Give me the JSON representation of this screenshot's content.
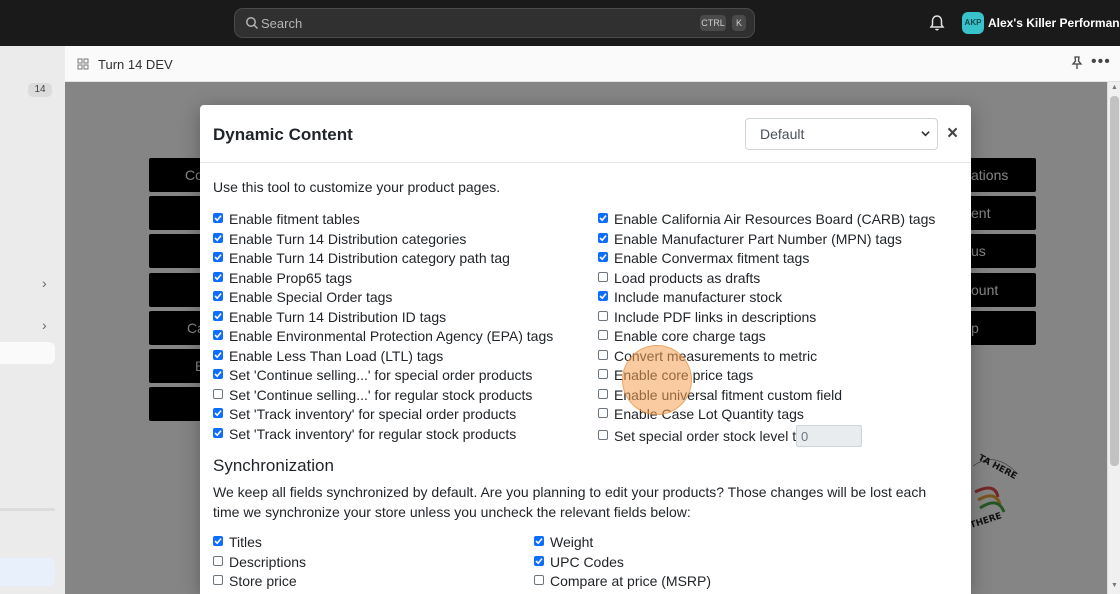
{
  "topbar": {
    "search_placeholder": "Search",
    "shortcut_keys": [
      "CTRL",
      "K"
    ],
    "account_initials": "AKP",
    "account_name": "Alex's Killer Performance"
  },
  "sidebar": {
    "badge": "14"
  },
  "app": {
    "title": "Turn 14 DEV"
  },
  "background_buttons": [
    "Co",
    "ations",
    "ent",
    "us",
    "ount",
    "Ca",
    "p",
    "B"
  ],
  "stamp_text": [
    "TA HERE",
    "THERE"
  ],
  "modal": {
    "title": "Dynamic Content",
    "select_value": "Default",
    "close": "×",
    "intro": "Use this tool to customize your product pages.",
    "left_options": [
      {
        "label": "Enable fitment tables",
        "checked": true
      },
      {
        "label": "Enable Turn 14 Distribution categories",
        "checked": true
      },
      {
        "label": "Enable Turn 14 Distribution category path tag",
        "checked": true
      },
      {
        "label": "Enable Prop65 tags",
        "checked": true
      },
      {
        "label": "Enable Special Order tags",
        "checked": true
      },
      {
        "label": "Enable Turn 14 Distribution ID tags",
        "checked": true
      },
      {
        "label": "Enable Environmental Protection Agency (EPA) tags",
        "checked": true
      },
      {
        "label": "Enable Less Than Load (LTL) tags",
        "checked": true
      },
      {
        "label": "Set 'Continue selling...' for special order products",
        "checked": true
      },
      {
        "label": "Set 'Continue selling...' for regular stock products",
        "checked": false
      },
      {
        "label": "Set 'Track inventory' for special order products",
        "checked": true
      },
      {
        "label": "Set 'Track inventory' for regular stock products",
        "checked": true
      }
    ],
    "right_options": [
      {
        "label": "Enable California Air Resources Board (CARB) tags",
        "checked": true
      },
      {
        "label": "Enable Manufacturer Part Number (MPN) tags",
        "checked": true
      },
      {
        "label": "Enable Convermax fitment tags",
        "checked": true
      },
      {
        "label": "Load products as drafts",
        "checked": false
      },
      {
        "label": "Include manufacturer stock",
        "checked": true
      },
      {
        "label": "Include PDF links in descriptions",
        "checked": false
      },
      {
        "label": "Enable core charge tags",
        "checked": false
      },
      {
        "label": "Convert measurements to metric",
        "checked": false
      },
      {
        "label": "Enable core price tags",
        "checked": false
      },
      {
        "label": "Enable universal fitment custom field",
        "checked": false
      },
      {
        "label": "Enable Case Lot Quantity tags",
        "checked": false
      },
      {
        "label": "Set special order stock level to:",
        "checked": false
      }
    ],
    "special_order_stock_level": "0",
    "sync_title": "Synchronization",
    "sync_text": "We keep all fields synchronized by default. Are you planning to edit your products? Those changes will be lost each time we synchronize your store unless you uncheck the relevant fields below:",
    "sync_left": [
      {
        "label": "Titles",
        "checked": true
      },
      {
        "label": "Descriptions",
        "checked": false
      },
      {
        "label": "Store price",
        "checked": false
      }
    ],
    "sync_right": [
      {
        "label": "Weight",
        "checked": true
      },
      {
        "label": "UPC Codes",
        "checked": true
      },
      {
        "label": "Compare at price (MSRP)",
        "checked": false
      }
    ]
  },
  "colors": {
    "accent": "#0d6efd",
    "topbar": "#1a1a1a",
    "click_marker": "#f6a054"
  }
}
